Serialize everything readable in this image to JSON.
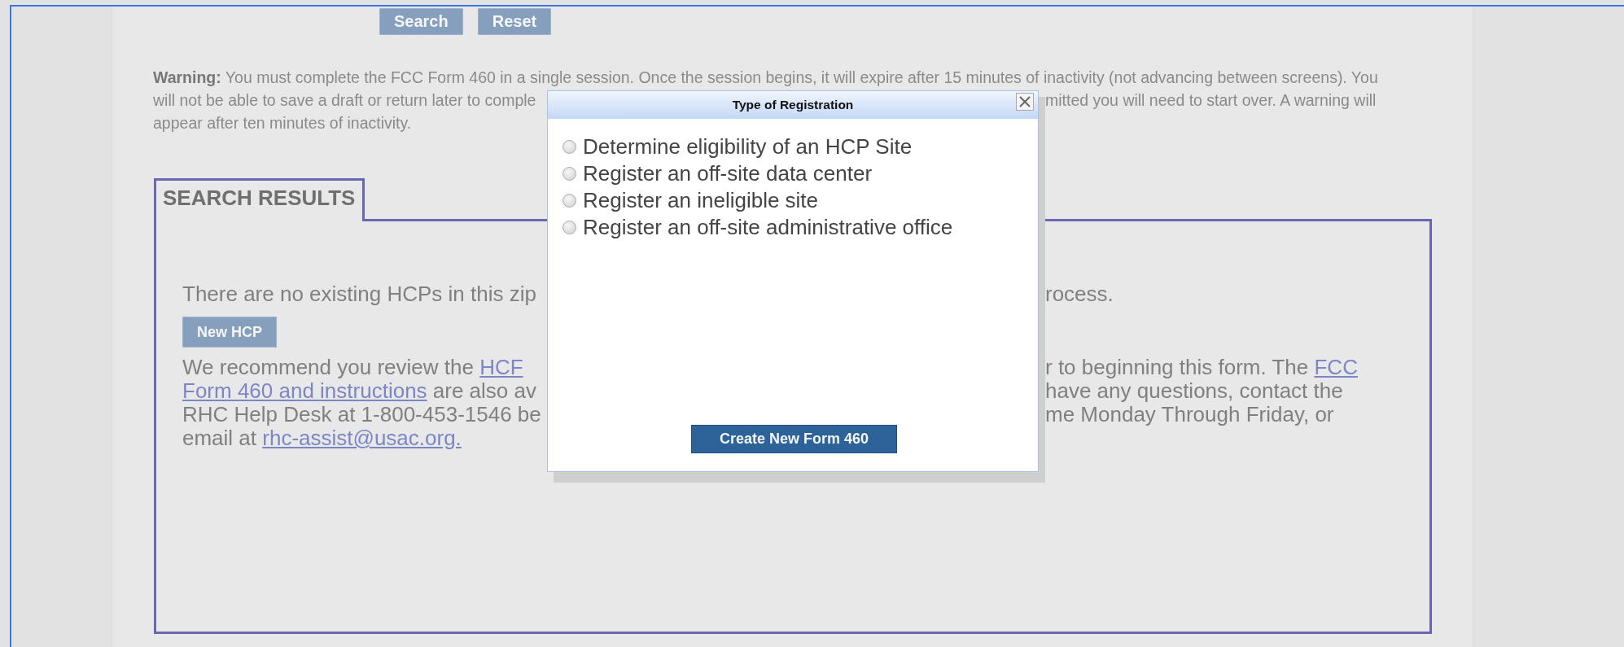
{
  "toolbar": {
    "buttons": [
      "Search",
      "Reset"
    ]
  },
  "warning": {
    "lines": [
      {
        "left": "**Warning:** You must complete the FCC Form 460 in a single session. Once the session begins, it will expire after 15 minutes of inactivity (not advancing between screens). You"
      },
      {
        "left": "will not be able to save a draft or return later to comple",
        "right": "mitted you will need to start over. A warning will"
      },
      {
        "left": "appear after ten minutes of inactivity."
      }
    ]
  },
  "search_results": {
    "tab": "SEARCH RESULTS",
    "message": {
      "left": "There are no existing HCPs in this zip",
      "right": "rocess."
    },
    "new_button": "New HCP",
    "paragraph": [
      {
        "left": [
          {
            "text": "We recommend you review the "
          },
          {
            "text": "HCF",
            "link": true
          }
        ],
        "right": [
          {
            "text": "r to beginning this form. The "
          },
          {
            "text": "FCC",
            "link": true
          }
        ]
      },
      {
        "left": [
          {
            "text": "Form 460 and instructions",
            "link": true
          },
          {
            "text": " are also av"
          }
        ],
        "right": [
          {
            "text": "have any questions, contact the"
          }
        ]
      },
      {
        "left": [
          {
            "text": "RHC Help Desk at 1-800-453-1546 be"
          }
        ],
        "right": [
          {
            "text": "me Monday Through Friday, or"
          }
        ]
      },
      {
        "left": [
          {
            "text": "email at "
          },
          {
            "text": "rhc-assist@usac.org.",
            "link": true
          }
        ]
      }
    ]
  },
  "dialog": {
    "title": "Type of Registration",
    "options": [
      {
        "label": "Determine eligibility of an HCP Site",
        "selected": false
      },
      {
        "label": "Register an off-site data center",
        "selected": false
      },
      {
        "label": "Register an ineligible site",
        "selected": false
      },
      {
        "label": "Register an off-site administrative office",
        "selected": false
      }
    ],
    "button": "Create New Form 460"
  }
}
